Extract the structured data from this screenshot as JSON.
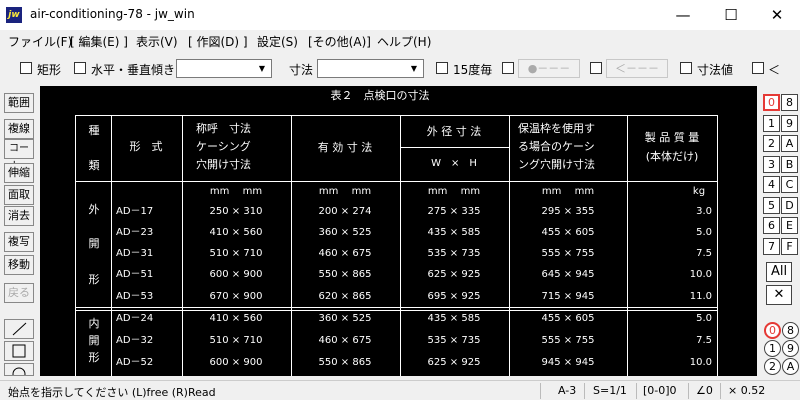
{
  "window": {
    "title": "air-conditioning-78 - jw_win",
    "icon_text": "jw",
    "minimize": "—",
    "maximize": "☐",
    "close": "✕"
  },
  "menu": [
    "ファイル(F)",
    "[ 編集(E) ]",
    "表示(V)",
    "[ 作図(D) ]",
    "設定(S)",
    "[その他(A)]",
    "ヘルプ(H)"
  ],
  "toolbar": {
    "rect_label": "矩形",
    "hv_label": "水平・垂直",
    "slope_label": "傾き",
    "dim_label": "寸法",
    "deg15_label": "15度毎",
    "circle_btn": "●－－－",
    "arrow_btn": "＜－－－",
    "dimval_label": "寸法値",
    "lt_label": "＜"
  },
  "left_tools": [
    "範囲",
    "複線",
    "コーナー",
    "伸縮",
    "面取",
    "消去",
    "複写",
    "移動",
    "戻る"
  ],
  "right_layers": {
    "col1": [
      "0",
      "1",
      "2",
      "3",
      "4",
      "5",
      "6",
      "7"
    ],
    "col2": [
      "8",
      "9",
      "A",
      "B",
      "C",
      "D",
      "E",
      "F"
    ],
    "all": "All",
    "cross": "✕",
    "group_col1": [
      "0",
      "1",
      "2"
    ],
    "group_col2": [
      "8",
      "9",
      "A"
    ]
  },
  "drawing": {
    "title": "表２　点検口の寸法",
    "head": {
      "h1a": "種",
      "h1b": "類",
      "h2": "形　式",
      "h3a": "称呼　寸法",
      "h3b": "ケーシング",
      "h3c": "穴開け寸法",
      "h4": "有 効 寸 法",
      "h5a": "外 径 寸 法",
      "h5b": "W　×　H",
      "h6a": "保温枠を使用す",
      "h6b": "る場合のケーシ",
      "h6c": "ング穴開け寸法",
      "h7a": "製 品 質 量",
      "h7b": "(本体だけ)"
    },
    "units": {
      "u3": "mm　 mm",
      "u4": "mm　 mm",
      "u5": "mm　 mm",
      "u6": "mm　 mm",
      "u7": "kg"
    },
    "group1": {
      "c1": "外",
      "c2": "開",
      "c3": "形"
    },
    "group2": {
      "c1": "内",
      "c2": "開",
      "c3": "形"
    },
    "rows1": [
      [
        "AD－17",
        "250 × 310",
        "200 × 274",
        "275 × 335",
        "295 × 355",
        "3.0"
      ],
      [
        "AD－23",
        "410 × 560",
        "360 × 525",
        "435 × 585",
        "455 × 605",
        "5.0"
      ],
      [
        "AD－31",
        "510 × 710",
        "460 × 675",
        "535 × 735",
        "555 × 755",
        "7.5"
      ],
      [
        "AD－51",
        "600 × 900",
        "550 × 865",
        "625 × 925",
        "645 × 945",
        "10.0"
      ],
      [
        "AD－53",
        "670 × 900",
        "620 × 865",
        "695 × 925",
        "715 × 945",
        "11.0"
      ]
    ],
    "rows2": [
      [
        "AD－24",
        "410 × 560",
        "360 × 525",
        "435 × 585",
        "455 × 605",
        "5.0"
      ],
      [
        "AD－32",
        "510 × 710",
        "460 × 675",
        "535 × 735",
        "555 × 755",
        "7.5"
      ],
      [
        "AD－52",
        "600 × 900",
        "550 × 865",
        "625 × 925",
        "945 × 945",
        "10.0"
      ]
    ]
  },
  "status": {
    "message": "始点を指示してください (L)free (R)Read",
    "paper": "A-3",
    "scale": "S=1/1",
    "layer": "[0-0]0",
    "angle": "∠0",
    "zoom": "× 0.52"
  },
  "colors": {
    "canvas_bg": "#000000",
    "drawing_line": "#ffffff",
    "active_layer": "#e53935"
  }
}
